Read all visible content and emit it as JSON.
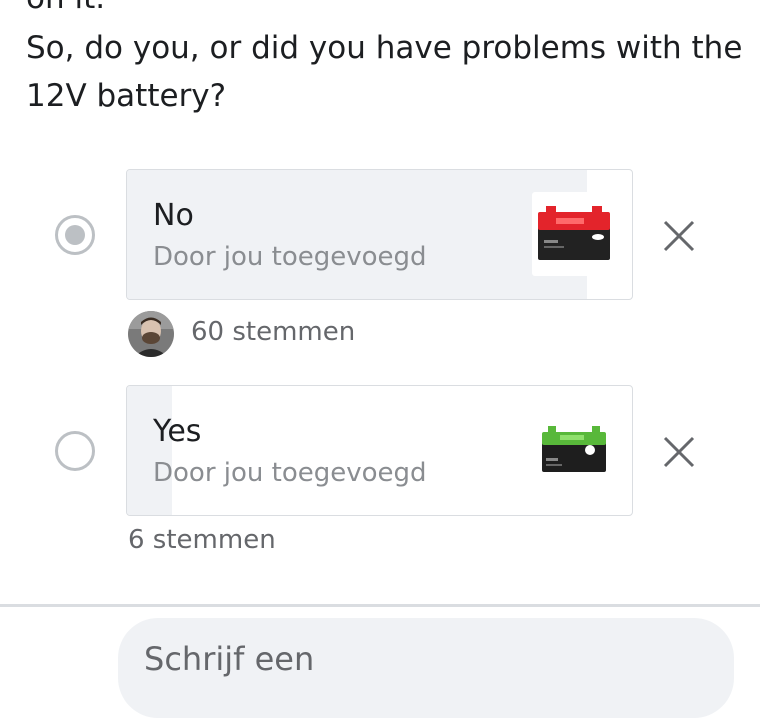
{
  "post": {
    "partial_text": "on it.",
    "question": "So, do you, or did you have problems with the 12V battery?"
  },
  "poll": {
    "options": [
      {
        "label": "No",
        "sub": "Door jou toegevoegd",
        "votes_text": "60 stemmen",
        "selected": true,
        "vote_share": 0.91,
        "thumb_icon": "red-motorcycle-battery-icon"
      },
      {
        "label": "Yes",
        "sub": "Door jou toegevoegd",
        "votes_text": "6 stemmen",
        "selected": false,
        "vote_share": 0.09,
        "thumb_icon": "green-lithium-battery-icon"
      }
    ]
  },
  "comment": {
    "placeholder": "Schrijf een"
  },
  "colors": {
    "text": "#1c1e21",
    "secondary": "#65676b",
    "muted": "#8a8d91",
    "radio": "#bcc0c4",
    "fill": "#f0f2f5",
    "border": "#dadde1"
  }
}
